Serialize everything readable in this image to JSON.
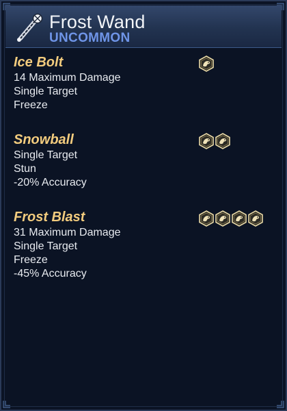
{
  "item": {
    "name": "Frost Wand",
    "rarity": "UNCOMMON",
    "icon": "wand-icon"
  },
  "colors": {
    "rarity": "#6f95e8",
    "ability_name": "#f3cc7e",
    "text": "#e8ebf0",
    "panel_bg": "#0b1324",
    "header_bg": "#223350"
  },
  "abilities": [
    {
      "name": "Ice Bolt",
      "cost": 1,
      "cost_icon": "action-point-icon",
      "lines": [
        "14 Maximum Damage",
        "Single Target",
        "Freeze"
      ]
    },
    {
      "name": "Snowball",
      "cost": 2,
      "cost_icon": "action-point-icon",
      "lines": [
        "Single Target",
        "Stun",
        "-20% Accuracy"
      ]
    },
    {
      "name": "Frost Blast",
      "cost": 4,
      "cost_icon": "action-point-icon",
      "lines": [
        "31 Maximum Damage",
        "Single Target",
        "Freeze",
        "-45% Accuracy"
      ]
    }
  ]
}
